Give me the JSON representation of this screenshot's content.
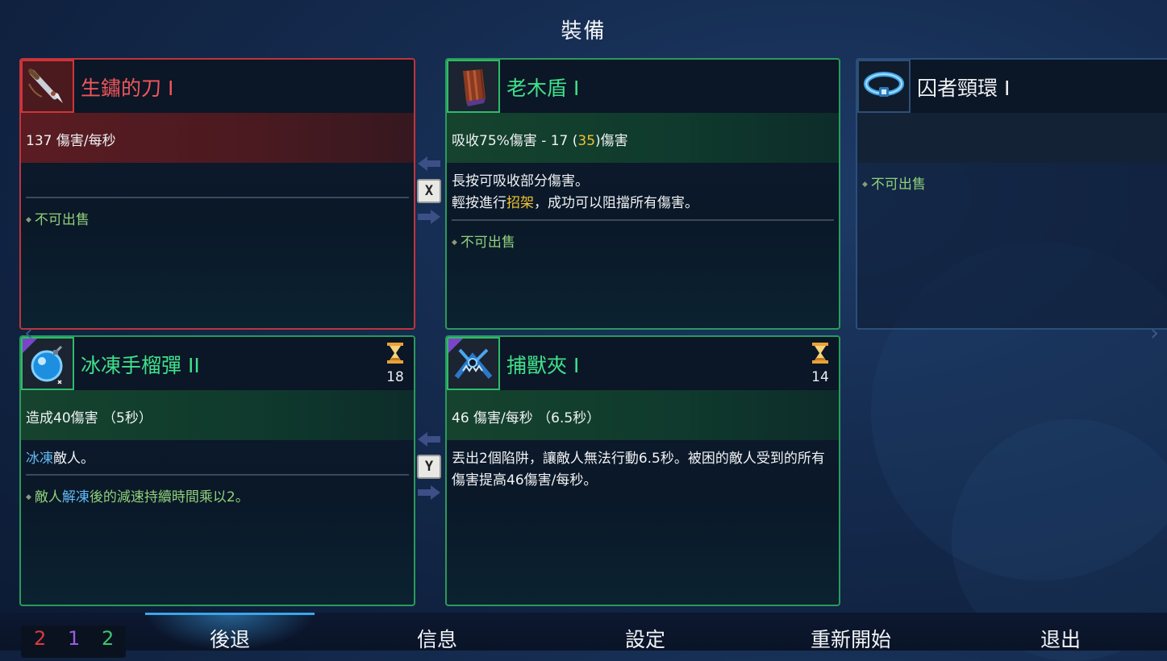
{
  "screen": {
    "title": "裝備"
  },
  "cards": {
    "weapon1": {
      "name": "生鏽的刀 I",
      "stat": "137 傷害/每秒",
      "note": "不可出售",
      "icon": "rusty-sword-icon",
      "color": "#c0343a"
    },
    "weapon2": {
      "name": "老木盾 I",
      "stat_prefix": "吸收75%傷害 - 17 (",
      "stat_highlight": "35",
      "stat_suffix": ")傷害",
      "desc_line1": "長按可吸收部分傷害。",
      "desc_line2_prefix": "輕按進行",
      "desc_line2_highlight": "招架",
      "desc_line2_suffix": "，成功可以阻擋所有傷害。",
      "note": "不可出售",
      "icon": "wooden-shield-icon",
      "color": "#2a9a5c"
    },
    "amulet": {
      "name": "囚者頸環 I",
      "note": "不可出售",
      "icon": "amulet-icon",
      "color": "#2a4f7a"
    },
    "skill1": {
      "name": "冰凍手榴彈 II",
      "cooldown": "18",
      "stat": "造成40傷害 （5秒）",
      "desc_highlight": "冰凍",
      "desc_suffix": "敵人。",
      "note_prefix": "敵人",
      "note_highlight": "解凍",
      "note_suffix": "後的減速持續時間乘以2。",
      "icon": "ice-grenade-icon",
      "color": "#2a9a5c"
    },
    "skill2": {
      "name": "捕獸夾 I",
      "cooldown": "14",
      "stat": "46 傷害/每秒 （6.5秒）",
      "desc": "丟出2個陷阱，讓敵人無法行動6.5秒。被困的敵人受到的所有傷害提高46傷害/每秒。",
      "icon": "bear-trap-icon",
      "color": "#2a9a5c"
    }
  },
  "swap_keys": {
    "top": "X",
    "bottom": "Y"
  },
  "footer": {
    "counters": [
      {
        "value": "2",
        "color": "#e0383e"
      },
      {
        "value": "1",
        "color": "#9a5ce0"
      },
      {
        "value": "2",
        "color": "#3ec46a"
      }
    ],
    "nav": [
      "後退",
      "信息",
      "設定",
      "重新開始",
      "退出"
    ],
    "active_nav": "後退"
  }
}
